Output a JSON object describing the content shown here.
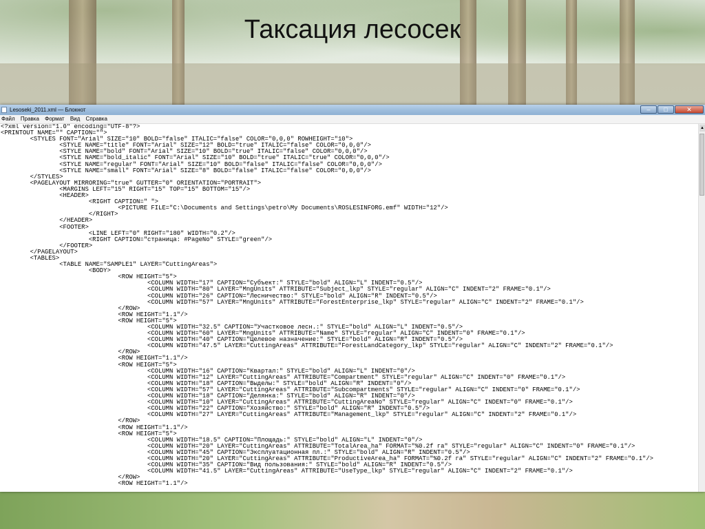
{
  "slide": {
    "title": "Таксация лесосек"
  },
  "window": {
    "title": "Lesoseki_2011.xml — Блокнот",
    "buttons": {
      "minimize": "–",
      "maximize": "□",
      "close": "✕"
    }
  },
  "menu": {
    "items": [
      "Файл",
      "Правка",
      "Формат",
      "Вид",
      "Справка"
    ]
  },
  "editor": {
    "lines": [
      "<?xml version=\"1.0\" encoding=\"UTF-8\"?>",
      "<PRINTOUT NAME=\"\" CAPTION=\"\">",
      "        <STYLES FONT=\"Arial\" SIZE=\"10\" BOLD=\"false\" ITALIC=\"false\" COLOR=\"0,0,0\" ROWHEIGHT=\"10\">",
      "                <STYLE NAME=\"title\" FONT=\"Arial\" SIZE=\"12\" BOLD=\"true\" ITALIC=\"false\" COLOR=\"0,0,0\"/>",
      "                <STYLE NAME=\"bold\" FONT=\"Arial\" SIZE=\"10\" BOLD=\"true\" ITALIC=\"false\" COLOR=\"0,0,0\"/>",
      "                <STYLE NAME=\"bold_italic\" FONT=\"Arial\" SIZE=\"10\" BOLD=\"true\" ITALIC=\"true\" COLOR=\"0,0,0\"/>",
      "                <STYLE NAME=\"regular\" FONT=\"Arial\" SIZE=\"10\" BOLD=\"false\" ITALIC=\"false\" COLOR=\"0,0,0\"/>",
      "                <STYLE NAME=\"small\" FONT=\"Arial\" SIZE=\"8\" BOLD=\"false\" ITALIC=\"false\" COLOR=\"0,0,0\"/>",
      "        </STYLES>",
      "        <PAGELAYOUT MIRRORING=\"true\" GUTTER=\"0\" ORIENTATION=\"PORTRAIT\">",
      "                <MARGINS LEFT=\"15\" RIGHT=\"15\" TOP=\"15\" BOTTOM=\"15\"/>",
      "                <HEADER>",
      "                        <RIGHT CAPTION=\" \">",
      "                                <PICTURE FILE=\"C:\\Documents and Settings\\petro\\My Documents\\ROSLESINFORG.emf\" WIDTH=\"12\"/>",
      "                        </RIGHT>",
      "                </HEADER>",
      "                <FOOTER>",
      "                        <LINE LEFT=\"0\" RIGHT=\"180\" WIDTH=\"0.2\"/>",
      "                        <RIGHT CAPTION=\"страница: #PageNo\" STYLE=\"green\"/>",
      "                </FOOTER>",
      "        </PAGELAYOUT>",
      "        <TABLES>",
      "                <TABLE NAME=\"SAMPLE1\" LAYER=\"CuttingAreas\">",
      "                        <BODY>",
      "                                <ROW HEIGHT=\"5\">",
      "                                        <COLUMN WIDTH=\"17\" CAPTION=\"Субъект:\" STYLE=\"bold\" ALIGN=\"L\" INDENT=\"0.5\"/>",
      "                                        <COLUMN WIDTH=\"80\" LAYER=\"MngUnits\" ATTRIBUTE=\"Subject_lkp\" STYLE=\"regular\" ALIGN=\"C\" INDENT=\"2\" FRAME=\"0.1\"/>",
      "                                        <COLUMN WIDTH=\"26\" CAPTION=\"Лесничество:\" STYLE=\"bold\" ALIGN=\"R\" INDENT=\"0.5\"/>",
      "                                        <COLUMN WIDTH=\"57\" LAYER=\"MngUnits\" ATTRIBUTE=\"ForestEnterprise_lkp\" STYLE=\"regular\" ALIGN=\"C\" INDENT=\"2\" FRAME=\"0.1\"/>",
      "                                </ROW>",
      "                                <ROW HEIGHT=\"1.1\"/>",
      "                                <ROW HEIGHT=\"5\">",
      "                                        <COLUMN WIDTH=\"32.5\" CAPTION=\"Участковое лесн.:\" STYLE=\"bold\" ALIGN=\"L\" INDENT=\"0.5\"/>",
      "                                        <COLUMN WIDTH=\"60\" LAYER=\"MngUnits\" ATTRIBUTE=\"Name\" STYLE=\"regular\" ALIGN=\"C\" INDENT=\"0\" FRAME=\"0.1\"/>",
      "                                        <COLUMN WIDTH=\"40\" CAPTION=\"Целевое назначение:\" STYLE=\"bold\" ALIGN=\"R\" INDENT=\"0.5\"/>",
      "                                        <COLUMN WIDTH=\"47.5\" LAYER=\"CuttingAreas\" ATTRIBUTE=\"ForestLandCategory_lkp\" STYLE=\"regular\" ALIGN=\"C\" INDENT=\"2\" FRAME=\"0.1\"/>",
      "                                </ROW>",
      "                                <ROW HEIGHT=\"1.1\"/>",
      "                                <ROW HEIGHT=\"5\">",
      "                                        <COLUMN WIDTH=\"16\" CAPTION=\"Квартал:\" STYLE=\"bold\" ALIGN=\"L\" INDENT=\"0\"/>",
      "                                        <COLUMN WIDTH=\"12\" LAYER=\"CuttingAreas\" ATTRIBUTE=\"Compartment\" STYLE=\"regular\" ALIGN=\"C\" INDENT=\"0\" FRAME=\"0.1\"/>",
      "                                        <COLUMN WIDTH=\"18\" CAPTION=\"Выделы:\" STYLE=\"bold\" ALIGN=\"R\" INDENT=\"0\"/>",
      "                                        <COLUMN WIDTH=\"57\" LAYER=\"CuttingAreas\" ATTRIBUTE=\"Subcompartments\" STYLE=\"regular\" ALIGN=\"C\" INDENT=\"0\" FRAME=\"0.1\"/>",
      "                                        <COLUMN WIDTH=\"18\" CAPTION=\"Делянка:\" STYLE=\"bold\" ALIGN=\"R\" INDENT=\"0\"/>",
      "                                        <COLUMN WIDTH=\"10\" LAYER=\"CuttingAreas\" ATTRIBUTE=\"CuttingAreaNo\" STYLE=\"regular\" ALIGN=\"C\" INDENT=\"0\" FRAME=\"0.1\"/>",
      "                                        <COLUMN WIDTH=\"22\" CAPTION=\"Хозяйство:\" STYLE=\"bold\" ALIGN=\"R\" INDENT=\"0.5\"/>",
      "                                        <COLUMN WIDTH=\"27\" LAYER=\"CuttingAreas\" ATTRIBUTE=\"Management_lkp\" STYLE=\"regular\" ALIGN=\"C\" INDENT=\"2\" FRAME=\"0.1\"/>",
      "                                </ROW>",
      "                                <ROW HEIGHT=\"1.1\"/>",
      "                                <ROW HEIGHT=\"5\">",
      "                                        <COLUMN WIDTH=\"18.5\" CAPTION=\"Площадь:\" STYLE=\"bold\" ALIGN=\"L\" INDENT=\"0\"/>",
      "                                        <COLUMN WIDTH=\"20\" LAYER=\"CuttingAreas\" ATTRIBUTE=\"TotalArea_ha\" FORMAT=\"%0.2f га\" STYLE=\"regular\" ALIGN=\"C\" INDENT=\"0\" FRAME=\"0.1\"/>",
      "                                        <COLUMN WIDTH=\"45\" CAPTION=\"Эксплуатационная пл.:\" STYLE=\"bold\" ALIGN=\"R\" INDENT=\"0.5\"/>",
      "                                        <COLUMN WIDTH=\"20\" LAYER=\"CuttingAreas\" ATTRIBUTE=\"ProductiveArea_ha\" FORMAT=\"%0.2f га\" STYLE=\"regular\" ALIGN=\"C\" INDENT=\"2\" FRAME=\"0.1\"/>",
      "                                        <COLUMN WIDTH=\"35\" CAPTION=\"Вид пользования:\" STYLE=\"bold\" ALIGN=\"R\" INDENT=\"0.5\"/>",
      "                                        <COLUMN WIDTH=\"41.5\" LAYER=\"CuttingAreas\" ATTRIBUTE=\"UseType_lkp\" STYLE=\"regular\" ALIGN=\"C\" INDENT=\"2\" FRAME=\"0.1\"/>",
      "                                </ROW>",
      "                                <ROW HEIGHT=\"1.1\"/>"
    ]
  }
}
